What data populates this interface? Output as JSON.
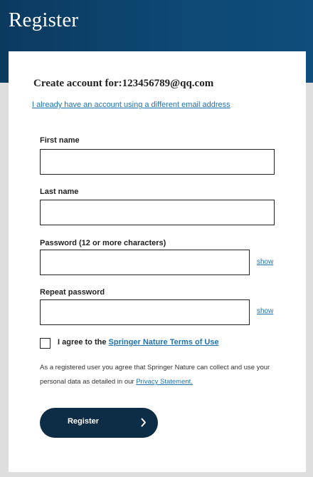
{
  "page": {
    "title": "Register"
  },
  "form": {
    "heading": "Create account for:123456789@qq.com",
    "alt_account_link": "I already have an account using a different email address",
    "first_name": {
      "label": "First name",
      "value": ""
    },
    "last_name": {
      "label": "Last name",
      "value": ""
    },
    "password": {
      "label": "Password (12 or more characters)",
      "value": "",
      "show_label": "show"
    },
    "repeat_password": {
      "label": "Repeat password",
      "value": "",
      "show_label": "show"
    },
    "terms": {
      "checked": false,
      "prefix": "I agree to the ",
      "link": "Springer Nature Terms of Use"
    },
    "consent": {
      "text": "As a registered user you agree that Springer Nature can collect and use your personal data as detailed in our ",
      "link": "Privacy Statement."
    },
    "submit_label": "Register"
  },
  "colors": {
    "header_bg": "#0e4773",
    "link": "#1f72b0",
    "button_bg": "#0d2c45",
    "page_bg": "#dedede"
  },
  "icons": {
    "submit_icon": "chevron-right-icon"
  }
}
